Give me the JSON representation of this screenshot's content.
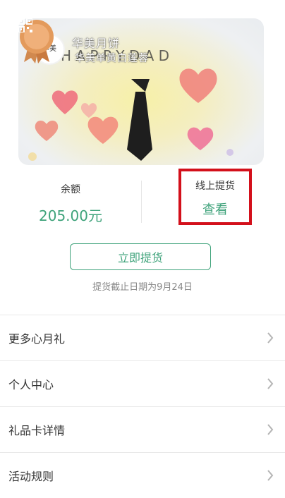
{
  "card": {
    "brand_name": "华美月饼",
    "product_name": "华美单黄白莲蓉",
    "logo_text_line1": "华",
    "logo_text_line2": "美",
    "background_art_text": "HAPPY DAD 节日快乐",
    "accent_color": "#3fa37b"
  },
  "stats": {
    "balance_label": "余额",
    "balance_value": "205.00元",
    "online_pickup_label": "线上提货",
    "online_pickup_action": "查看",
    "highlight_color": "#d3101b"
  },
  "actions": {
    "pickup_button": "立即提货",
    "deadline_text": "提货截止日期为9月24日"
  },
  "menu": {
    "items": [
      {
        "label": "更多心月礼"
      },
      {
        "label": "个人中心"
      },
      {
        "label": "礼品卡详情"
      },
      {
        "label": "活动规则"
      }
    ]
  }
}
